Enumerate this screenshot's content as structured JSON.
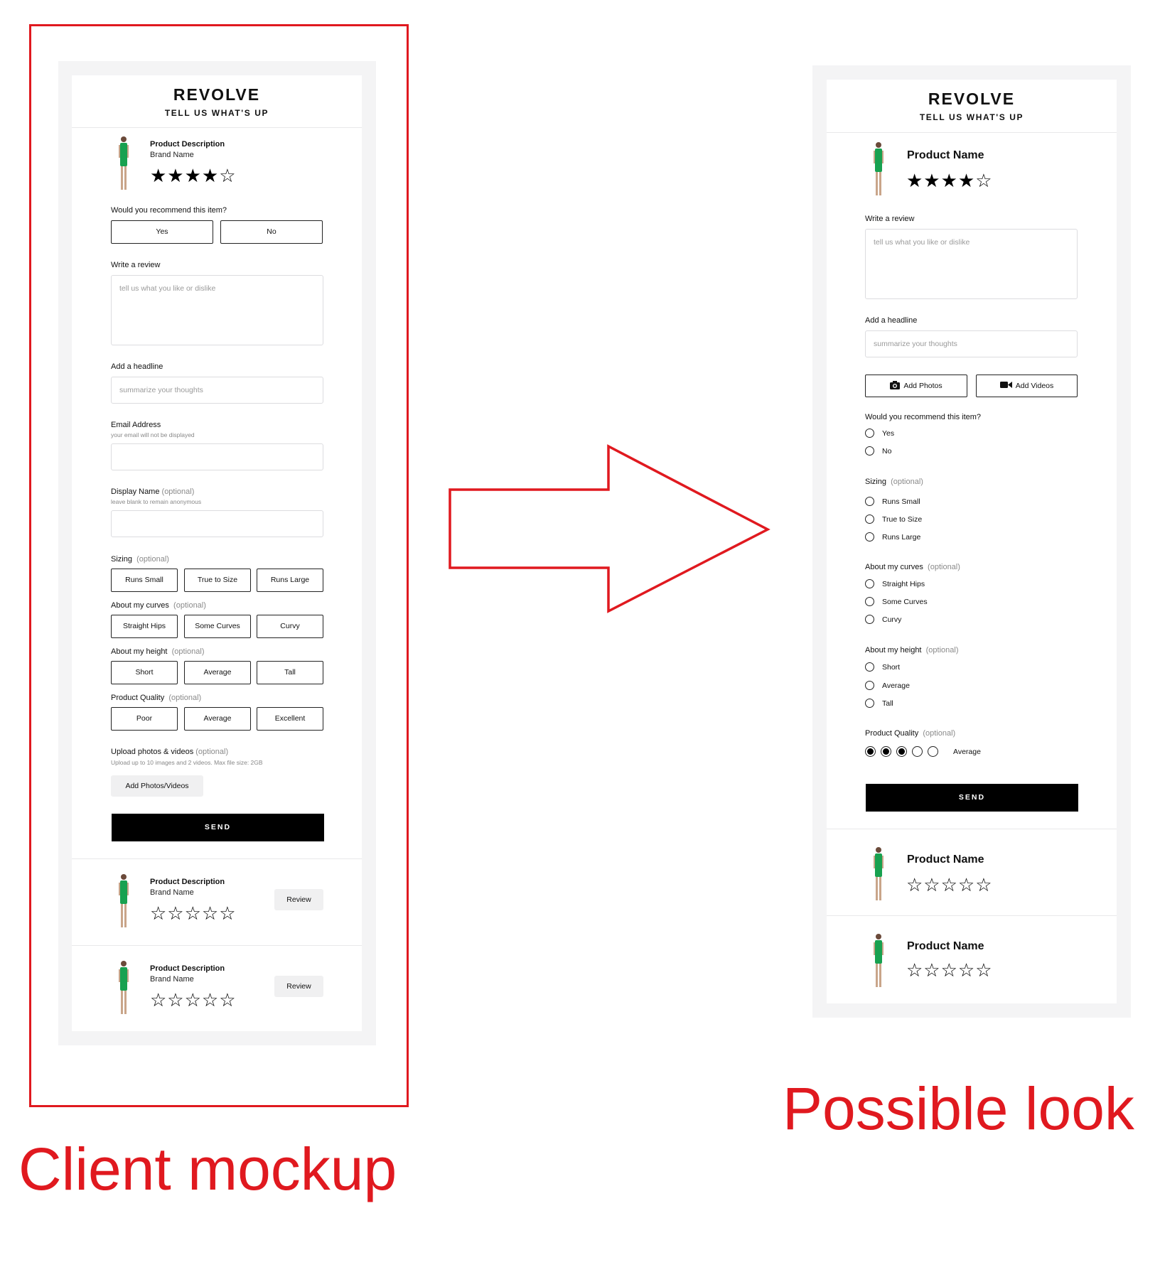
{
  "brand": {
    "logo": "REVOLVE",
    "tagline": "TELL US WHAT'S UP"
  },
  "colors": {
    "accent": "#e0191f",
    "panel": "#f4f4f5",
    "button": "#000000",
    "dress": "#18a150"
  },
  "left": {
    "product": {
      "description": "Product Description",
      "brand": "Brand Name",
      "stars": "★★★★☆"
    },
    "recommend": {
      "label": "Would you recommend this item?",
      "yes": "Yes",
      "no": "No"
    },
    "review": {
      "label": "Write a review",
      "placeholder": "tell us what you like or dislike"
    },
    "headline": {
      "label": "Add a headline",
      "placeholder": "summarize your thoughts"
    },
    "email": {
      "label": "Email Address",
      "hint": "your email will not be displayed"
    },
    "display_name": {
      "label": "Display Name",
      "optional": "(optional)",
      "hint": "leave blank to remain anonymous"
    },
    "sizing": {
      "label": "Sizing",
      "optional": "(optional)",
      "options": [
        "Runs Small",
        "True to Size",
        "Runs Large"
      ]
    },
    "curves": {
      "label": "About my curves",
      "optional": "(optional)",
      "options": [
        "Straight Hips",
        "Some Curves",
        "Curvy"
      ]
    },
    "height": {
      "label": "About my height",
      "optional": "(optional)",
      "options": [
        "Short",
        "Average",
        "Tall"
      ]
    },
    "quality": {
      "label": "Product Quality",
      "optional": "(optional)",
      "options": [
        "Poor",
        "Average",
        "Excellent"
      ]
    },
    "upload": {
      "label": "Upload photos & videos",
      "optional": "(optional)",
      "hint": "Upload up to 10 images and 2 videos. Max file size: 2GB",
      "button": "Add Photos/Videos"
    },
    "send": "SEND",
    "other_products": [
      {
        "description": "Product Description",
        "brand": "Brand Name",
        "stars": "☆☆☆☆☆",
        "button": "Review"
      },
      {
        "description": "Product Description",
        "brand": "Brand Name",
        "stars": "☆☆☆☆☆",
        "button": "Review"
      }
    ]
  },
  "right": {
    "product": {
      "name": "Product Name",
      "stars": "★★★★☆"
    },
    "review": {
      "label": "Write a review",
      "placeholder": "tell us what you like or dislike"
    },
    "headline": {
      "label": "Add a headline",
      "placeholder": "summarize your thoughts"
    },
    "add_photos": "Add Photos",
    "add_videos": "Add Videos",
    "recommend": {
      "label": "Would you recommend this item?",
      "options": [
        "Yes",
        "No"
      ]
    },
    "sizing": {
      "label": "Sizing",
      "optional": "(optional)",
      "options": [
        "Runs Small",
        "True to Size",
        "Runs Large"
      ]
    },
    "curves": {
      "label": "About my curves",
      "optional": "(optional)",
      "options": [
        "Straight Hips",
        "Some Curves",
        "Curvy"
      ]
    },
    "height": {
      "label": "About my height",
      "optional": "(optional)",
      "options": [
        "Short",
        "Average",
        "Tall"
      ]
    },
    "quality": {
      "label": "Product Quality",
      "optional": "(optional)",
      "value_label": "Average",
      "rating": 3,
      "max": 5
    },
    "send": "SEND",
    "other_products": [
      {
        "name": "Product Name",
        "stars": "☆☆☆☆☆"
      },
      {
        "name": "Product Name",
        "stars": "☆☆☆☆☆"
      }
    ]
  },
  "captions": {
    "left": "Client mockup",
    "right": "Possible look"
  }
}
